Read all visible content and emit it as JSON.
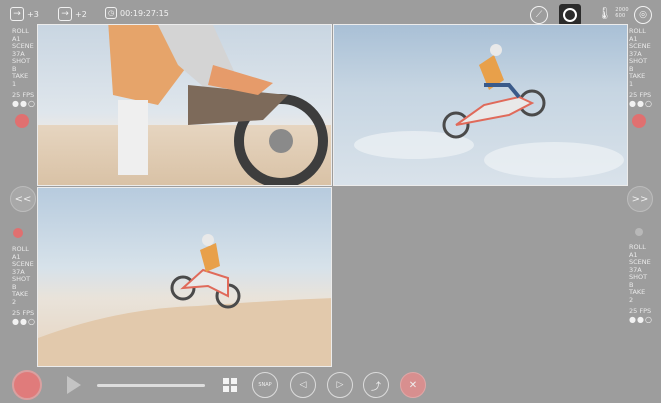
{
  "topbar": {
    "input1_label": "+3",
    "input2_label": "+2",
    "clock": "00:19:27:15",
    "clock_icon": "clock-icon",
    "storage_mini": [
      "2000",
      "600"
    ],
    "icons": [
      "arrow-in-icon",
      "arrow-in-icon",
      "gauge-icon",
      "gear-icon",
      "thermometer-icon",
      "globe-icon"
    ]
  },
  "panels": {
    "left_top": {
      "roll_label": "ROLL",
      "roll": "A1",
      "scene_label": "SCENE",
      "scene": "37A",
      "shot_label": "SHOT",
      "shot": "B",
      "take_label": "TAKE",
      "take": "1",
      "fps": "25 FPS",
      "dots": "●●○"
    },
    "right_top": {
      "roll_label": "ROLL",
      "roll": "A1",
      "scene_label": "SCENE",
      "scene": "37A",
      "shot_label": "SHOT",
      "shot": "B",
      "take_label": "TAKE",
      "take": "1",
      "fps": "25 FPS",
      "dots": "●●○"
    },
    "left_bottom": {
      "roll_label": "ROLL",
      "roll": "A1",
      "scene_label": "SCENE",
      "scene": "37A",
      "shot_label": "SHOT",
      "shot": "B",
      "take_label": "TAKE",
      "take": "2",
      "fps": "25 FPS",
      "dots": "●●○"
    },
    "right_bottom": {
      "roll_label": "ROLL",
      "roll": "A1",
      "scene_label": "SCENE",
      "scene": "37A",
      "shot_label": "SHOT",
      "shot": "B",
      "take_label": "TAKE",
      "take": "2",
      "fps": "25 FPS",
      "dots": "●●○"
    }
  },
  "nav": {
    "prev": "<<",
    "next": ">>"
  },
  "bottombar": {
    "snap_label": "SNAP",
    "prev_label": "◁",
    "next_label": "▷",
    "share_label": "⤴",
    "close_label": "✕",
    "progress": 0.0
  },
  "colors": {
    "record": "#e07070",
    "background": "#9d9d9d"
  }
}
